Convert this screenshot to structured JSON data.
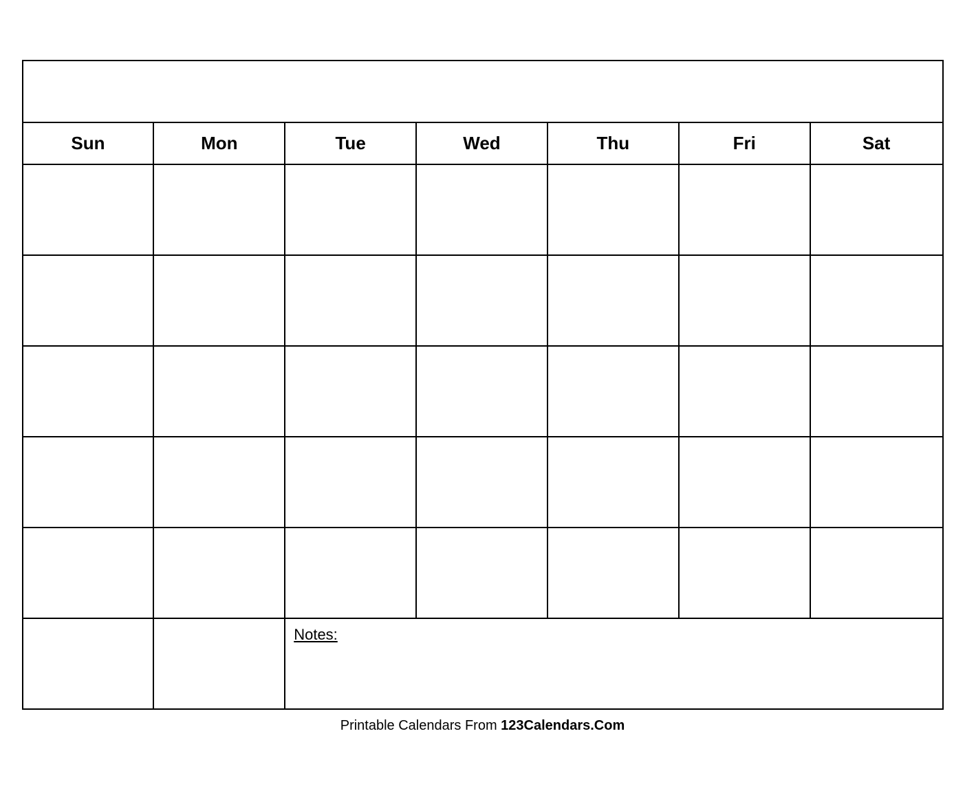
{
  "calendar": {
    "title": "",
    "days": [
      "Sun",
      "Mon",
      "Tue",
      "Wed",
      "Thu",
      "Fri",
      "Sat"
    ],
    "notes_label": "Notes:",
    "rows": 5
  },
  "footer": {
    "text_normal": "Printable Calendars From ",
    "text_bold": "123Calendars.Com"
  }
}
